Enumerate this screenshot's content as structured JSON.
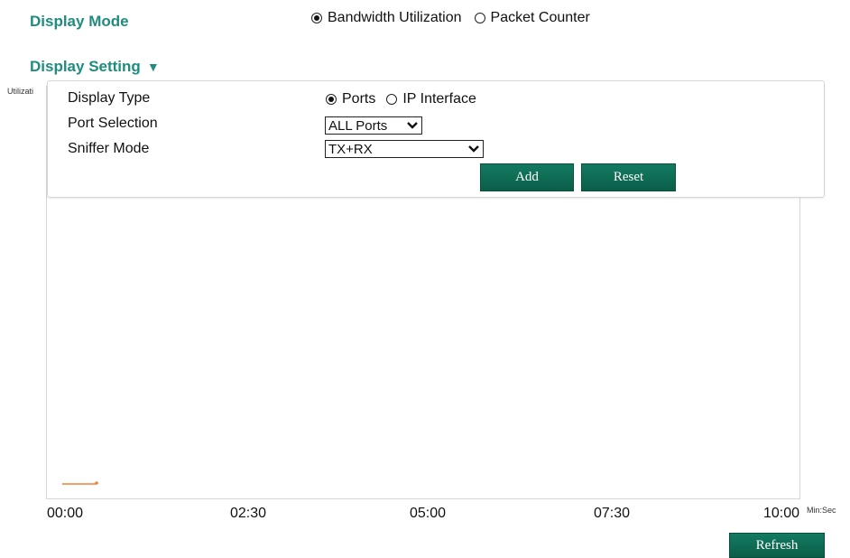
{
  "display_mode": {
    "label": "Display Mode",
    "options": [
      "Bandwidth Utilization",
      "Packet Counter"
    ],
    "selected": "Bandwidth Utilization"
  },
  "display_setting": {
    "label": "Display Setting",
    "toggle_glyph": "▼",
    "display_type": {
      "label": "Display Type",
      "options": [
        "Ports",
        "IP Interface"
      ],
      "selected": "Ports"
    },
    "port_selection": {
      "label": "Port Selection",
      "value": "ALL Ports"
    },
    "sniffer_mode": {
      "label": "Sniffer Mode",
      "value": "TX+RX"
    },
    "add_button": "Add",
    "reset_button": "Reset"
  },
  "chart": {
    "y_axis_label_visible": "Utilizati",
    "x_axis_unit": "Min:Sec",
    "x_ticks": [
      "00:00",
      "02:30",
      "05:00",
      "07:30",
      "10:00"
    ],
    "series_color": "#f07e3a"
  },
  "refresh_button": "Refresh",
  "colors": {
    "accent": "#1e8d7e",
    "button": "#0b6b53"
  }
}
